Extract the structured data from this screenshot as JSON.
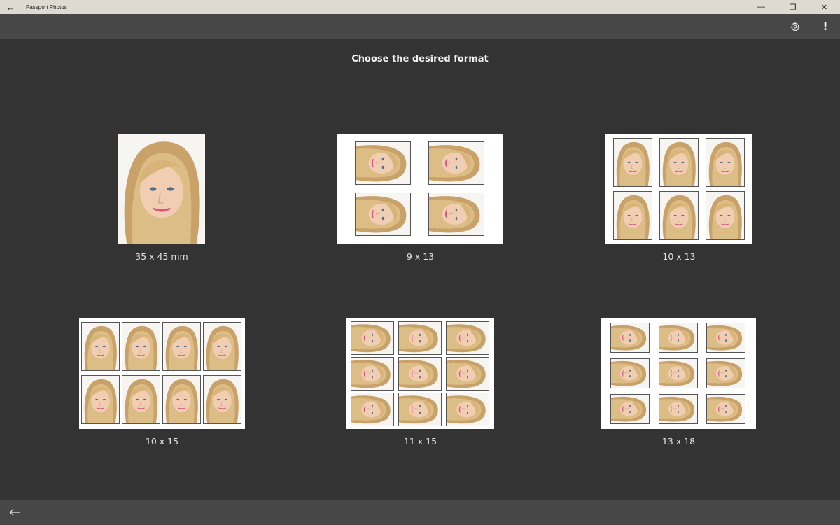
{
  "window": {
    "title": "Passport Photos",
    "back_glyph": "←",
    "minimize_glyph": "—",
    "restore_glyph": "❐",
    "close_glyph": "✕"
  },
  "appbar": {
    "settings_icon": "gear-icon",
    "info_label": "!"
  },
  "heading": "Choose the desired format",
  "formats": [
    {
      "label": "35 x 45 mm",
      "photos": 1
    },
    {
      "label": "9 x 13",
      "photos": 4
    },
    {
      "label": "10 x 13",
      "photos": 6
    },
    {
      "label": "10 x 15",
      "photos": 8
    },
    {
      "label": "11 x 15",
      "photos": 9
    },
    {
      "label": "13 x 18",
      "photos": 9
    }
  ],
  "colors": {
    "background": "#333333",
    "bar": "#474747",
    "titlebar": "#dedad2",
    "text": "#e2e2e2"
  }
}
